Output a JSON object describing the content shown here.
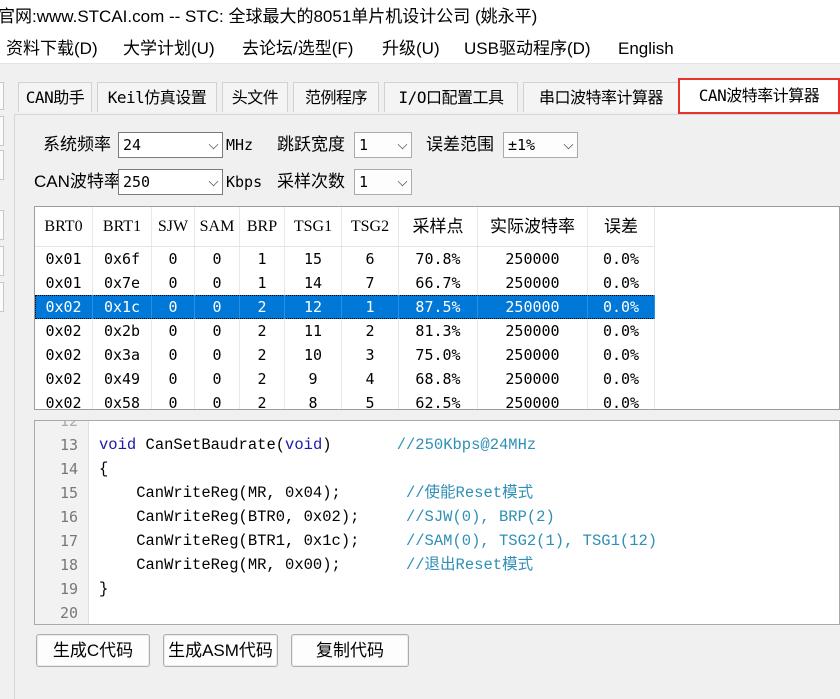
{
  "window": {
    "title": "官网:www.STCAI.com  -- STC: 全球最大的8051单片机设计公司 (姚永平)"
  },
  "menu": [
    "资料下载(D)",
    "大学计划(U)",
    "去论坛/选型(F)",
    "升级(U)",
    "USB驱动程序(D)",
    "English"
  ],
  "tabs": [
    "CAN助手",
    "Keil仿真设置",
    "头文件",
    "范例程序",
    "I/O口配置工具",
    "串口波特率计算器",
    "CAN波特率计算器"
  ],
  "active_tab": "CAN波特率计算器",
  "form": {
    "sysfreq_label": "系统频率",
    "sysfreq_value": "24",
    "sysfreq_unit": "MHz",
    "sjw_label": "跳跃宽度",
    "sjw_value": "1",
    "err_label": "误差范围",
    "err_value": "±1%",
    "baud_label": "CAN波特率",
    "baud_value": "250",
    "baud_unit": "Kbps",
    "sample_label": "采样次数",
    "sample_value": "1"
  },
  "table": {
    "headers": [
      "BRT0",
      "BRT1",
      "SJW",
      "SAM",
      "BRP",
      "TSG1",
      "TSG2",
      "采样点",
      "实际波特率",
      "误差"
    ],
    "selected_row": 2,
    "rows": [
      [
        "0x01",
        "0x6f",
        "0",
        "0",
        "1",
        "15",
        "6",
        "70.8%",
        "250000",
        "0.0%"
      ],
      [
        "0x01",
        "0x7e",
        "0",
        "0",
        "1",
        "14",
        "7",
        "66.7%",
        "250000",
        "0.0%"
      ],
      [
        "0x02",
        "0x1c",
        "0",
        "0",
        "2",
        "12",
        "1",
        "87.5%",
        "250000",
        "0.0%"
      ],
      [
        "0x02",
        "0x2b",
        "0",
        "0",
        "2",
        "11",
        "2",
        "81.3%",
        "250000",
        "0.0%"
      ],
      [
        "0x02",
        "0x3a",
        "0",
        "0",
        "2",
        "10",
        "3",
        "75.0%",
        "250000",
        "0.0%"
      ],
      [
        "0x02",
        "0x49",
        "0",
        "0",
        "2",
        "9",
        "4",
        "68.8%",
        "250000",
        "0.0%"
      ],
      [
        "0x02",
        "0x58",
        "0",
        "0",
        "2",
        "8",
        "5",
        "62.5%",
        "250000",
        "0.0%"
      ]
    ]
  },
  "code": {
    "lines": [
      {
        "num": "13",
        "kw": "void",
        "text": " CanSetBaudrate(",
        "kw2": "void",
        "text2": ")       ",
        "comment": "//250Kbps@24MHz"
      },
      {
        "num": "14",
        "kw": "",
        "text": "{",
        "kw2": "",
        "text2": "",
        "comment": ""
      },
      {
        "num": "15",
        "kw": "",
        "text": "    CanWriteReg(MR, 0x04);       ",
        "kw2": "",
        "text2": "",
        "comment": "//使能Reset模式"
      },
      {
        "num": "16",
        "kw": "",
        "text": "    CanWriteReg(BTR0, 0x02);     ",
        "kw2": "",
        "text2": "",
        "comment": "//SJW(0), BRP(2)"
      },
      {
        "num": "17",
        "kw": "",
        "text": "    CanWriteReg(BTR1, 0x1c);     ",
        "kw2": "",
        "text2": "",
        "comment": "//SAM(0), TSG2(1), TSG1(12)"
      },
      {
        "num": "18",
        "kw": "",
        "text": "    CanWriteReg(MR, 0x00);       ",
        "kw2": "",
        "text2": "",
        "comment": "//退出Reset模式"
      },
      {
        "num": "19",
        "kw": "",
        "text": "}",
        "kw2": "",
        "text2": "",
        "comment": ""
      },
      {
        "num": "20",
        "kw": "",
        "text": "",
        "kw2": "",
        "text2": "",
        "comment": ""
      }
    ]
  },
  "buttons": {
    "gen_c": "生成C代码",
    "gen_asm": "生成ASM代码",
    "copy": "复制代码"
  }
}
